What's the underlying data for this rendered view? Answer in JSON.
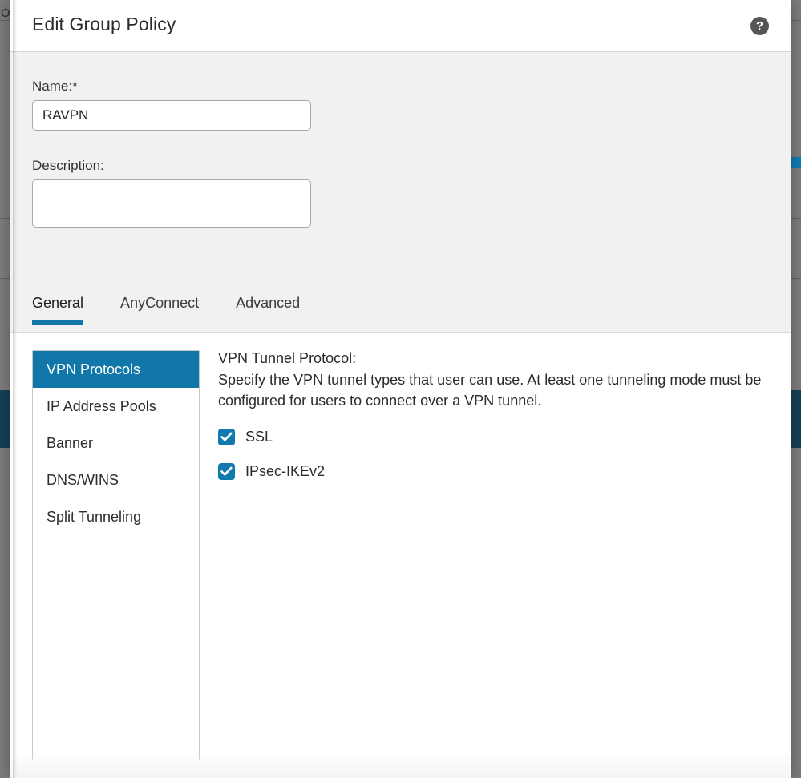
{
  "background": {
    "partial_label": "Ov",
    "rail_color": "#7b7b7b",
    "selected_item_color": "#173f54",
    "accent_color": "#0f7bad"
  },
  "dialog": {
    "title": "Edit Group Policy",
    "help_icon": "help-question-icon",
    "help_glyph": "?"
  },
  "form": {
    "name_label": "Name:*",
    "name_value": "RAVPN",
    "name_placeholder": "",
    "description_label": "Description:",
    "description_value": "",
    "description_placeholder": ""
  },
  "tabs": [
    {
      "label": "General",
      "active": true
    },
    {
      "label": "AnyConnect",
      "active": false
    },
    {
      "label": "Advanced",
      "active": false
    }
  ],
  "sidebar": {
    "items": [
      {
        "label": "VPN Protocols",
        "selected": true
      },
      {
        "label": "IP Address Pools",
        "selected": false
      },
      {
        "label": "Banner",
        "selected": false
      },
      {
        "label": "DNS/WINS",
        "selected": false
      },
      {
        "label": "Split Tunneling",
        "selected": false
      }
    ]
  },
  "pane": {
    "title": "VPN Tunnel Protocol:",
    "description": "Specify the VPN tunnel types that user can use. At least one tunneling mode must be configured for users to connect over a VPN tunnel.",
    "checkboxes": [
      {
        "label": "SSL",
        "checked": true
      },
      {
        "label": "IPsec-IKEv2",
        "checked": true
      }
    ]
  },
  "colors": {
    "accent": "#1077a8",
    "checkbox_fill": "#1079ad",
    "body_bg": "#f1f1f1",
    "panel_bg": "#ffffff"
  }
}
